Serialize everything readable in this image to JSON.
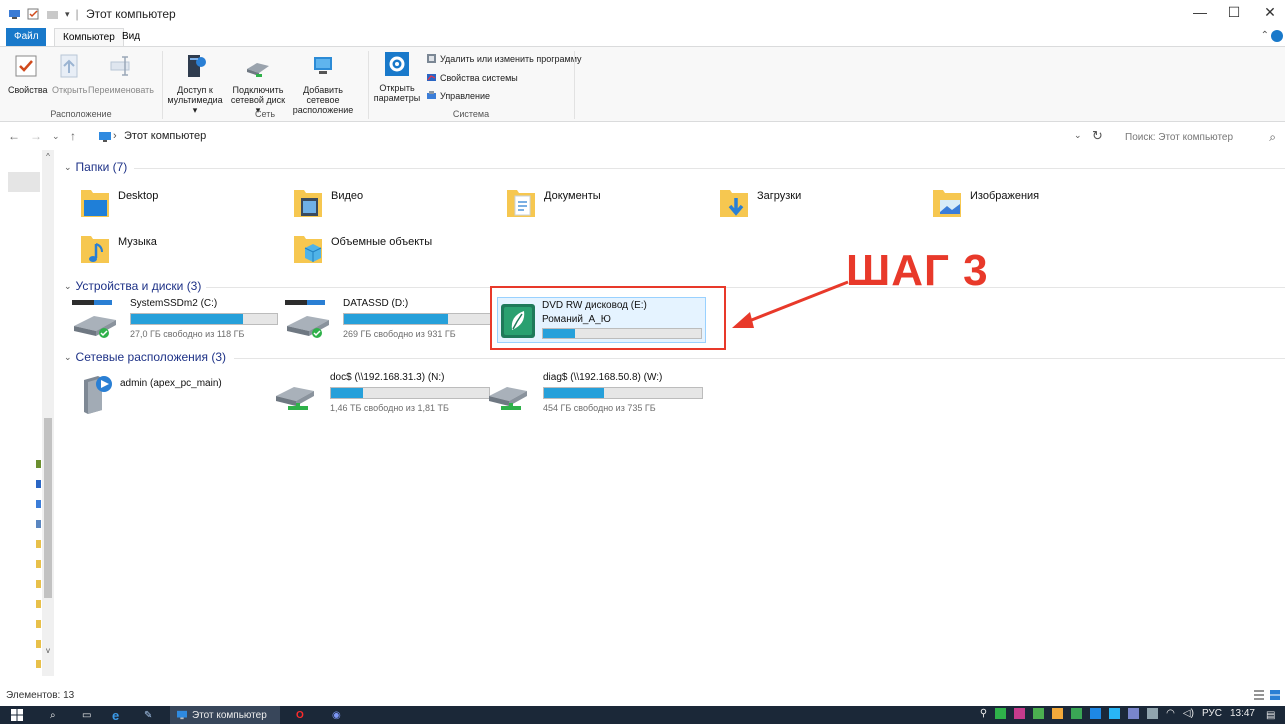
{
  "window": {
    "title": "Этот компьютер",
    "controls": {
      "minimize": "—",
      "maximize": "☐",
      "close": "✕"
    }
  },
  "ribbon": {
    "tabs": [
      {
        "label": "Файл"
      },
      {
        "label": "Компьютер"
      },
      {
        "label": "Вид"
      }
    ],
    "groups": {
      "location": {
        "label": "Расположение",
        "buttons": [
          "Свойства",
          "Открыть",
          "Переименовать"
        ]
      },
      "network": {
        "label": "Сеть",
        "buttons": [
          {
            "line1": "Доступ к",
            "line2": "мультимедиа ▾"
          },
          {
            "line1": "Подключить",
            "line2": "сетевой диск ▾"
          },
          {
            "line1": "Добавить сетевое",
            "line2": "расположение"
          }
        ]
      },
      "system": {
        "label": "Система",
        "open_settings": {
          "line1": "Открыть",
          "line2": "параметры"
        },
        "small": [
          "Удалить или изменить программу",
          "Свойства системы",
          "Управление"
        ]
      }
    }
  },
  "address": {
    "path": "Этот компьютер",
    "separator": "›",
    "search_placeholder": "Поиск: Этот компьютер"
  },
  "sections": {
    "folders": {
      "header": "Папки (7)",
      "items": [
        "Desktop",
        "Видео",
        "Документы",
        "Загрузки",
        "Изображения",
        "Музыка",
        "Объемные объекты"
      ]
    },
    "drives": {
      "header": "Устройства и диски (3)",
      "items": [
        {
          "name": "SystemSSDm2 (C:)",
          "free": "27,0 ГБ свободно из 118 ГБ",
          "used": 0.77
        },
        {
          "name": "DATASSD (D:)",
          "free": "269 ГБ свободно из 931 ГБ",
          "used": 0.71
        },
        {
          "name": "DVD RW дисковод (E:)",
          "label": "Романий_А_Ю",
          "used": 0.2
        }
      ]
    },
    "network": {
      "header": "Сетевые расположения (3)",
      "items": [
        {
          "name": "admin (apex_pc_main)"
        },
        {
          "name": "doc$ (\\\\192.168.31.3) (N:)",
          "free": "1,46 ТБ свободно из 1,81 ТБ",
          "used": 0.2
        },
        {
          "name": "diag$ (\\\\192.168.50.8) (W:)",
          "free": "454 ГБ свободно из 735 ГБ",
          "used": 0.38
        }
      ]
    }
  },
  "annotation": {
    "text": "ШАГ 3"
  },
  "status": {
    "items_count": "Элементов: 13"
  },
  "taskbar": {
    "explorer_label": "Этот компьютер",
    "lang": "РУС",
    "time": "13:47"
  },
  "colors": {
    "accent": "#1979ca",
    "bar_fill": "#26a0da",
    "annotation": "#e8392a",
    "folder": "#f6c750"
  }
}
